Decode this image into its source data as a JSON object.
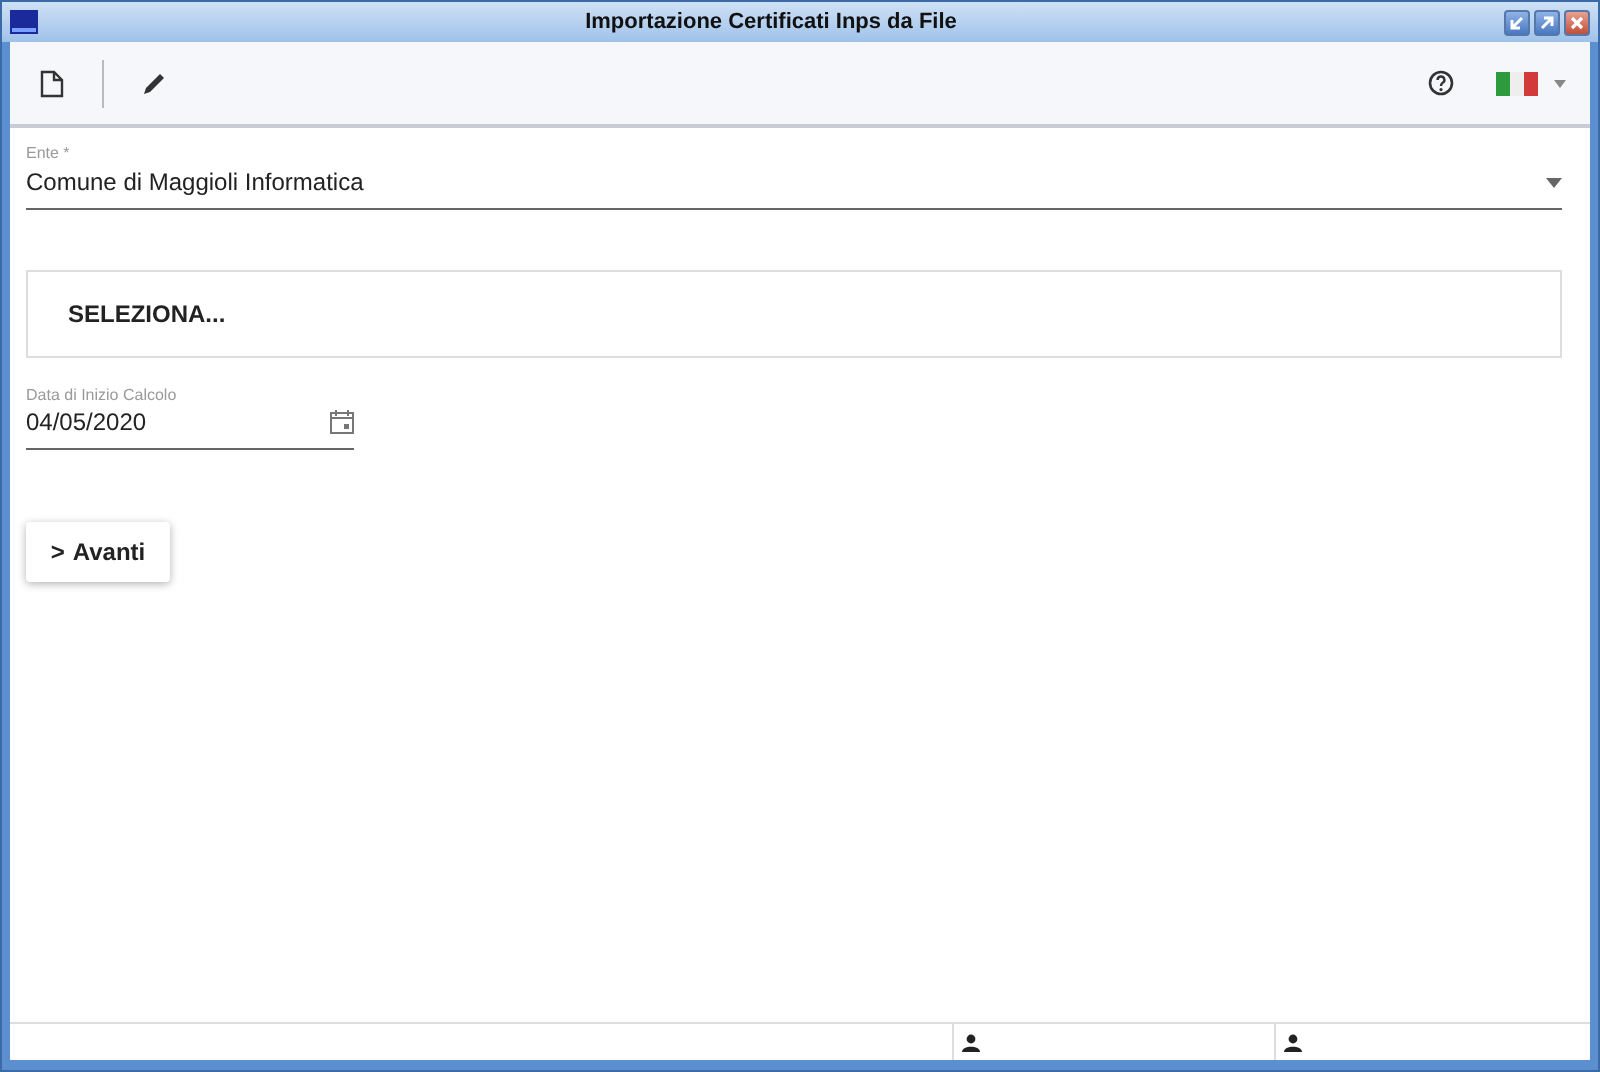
{
  "window": {
    "title": "Importazione Certificati Inps da File"
  },
  "form": {
    "ente": {
      "label": "Ente *",
      "value": "Comune di Maggioli Informatica"
    },
    "select_button": "SELEZIONA...",
    "date": {
      "label": "Data di Inizio Calcolo",
      "value": "04/05/2020"
    },
    "next_button": {
      "icon": ">",
      "label": "Avanti"
    }
  }
}
